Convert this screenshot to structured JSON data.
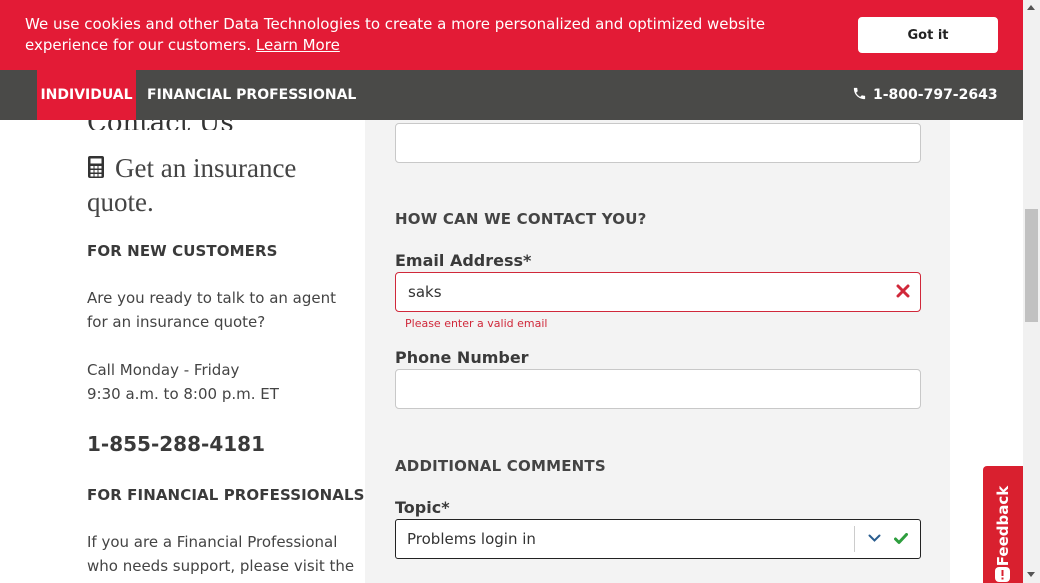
{
  "cookie_banner": {
    "text": "We use cookies and other Data Technologies to create a more personalized and optimized website experience for our customers.",
    "learn_more": "Learn More",
    "button": "Got it"
  },
  "nav": {
    "tab_individual": "INDIVIDUAL",
    "tab_financial": "FINANCIAL PROFESSIONAL",
    "phone": "1-800-797-2643"
  },
  "left": {
    "partial_heading": "Contact Us",
    "quote_heading": "Get an insurance quote.",
    "new_customers_title": "FOR NEW CUSTOMERS",
    "new_customers_text": "Are you ready to talk to an agent for an insurance quote?",
    "hours_line1": "Call Monday - Friday",
    "hours_line2": "9:30 a.m. to 8:00 p.m. ET",
    "quote_phone": "1-855-288-4181",
    "fp_title": "FOR FINANCIAL PROFESSIONALS",
    "fp_text": "If you are a Financial Professional who needs support, please visit the"
  },
  "form": {
    "contact_section": "HOW CAN WE CONTACT YOU?",
    "email_label": "Email Address*",
    "email_value": "saks",
    "email_error": "Please enter a valid email",
    "phone_label": "Phone Number",
    "phone_value": "",
    "comments_section": "ADDITIONAL COMMENTS",
    "topic_label": "Topic*",
    "topic_value": "Problems login in"
  },
  "feedback": {
    "label": "Feedback"
  },
  "colors": {
    "brand_red": "#e31b36",
    "nav_gray": "#4a4a48",
    "error_red": "#d0283a",
    "success_green": "#2e9e3e"
  }
}
